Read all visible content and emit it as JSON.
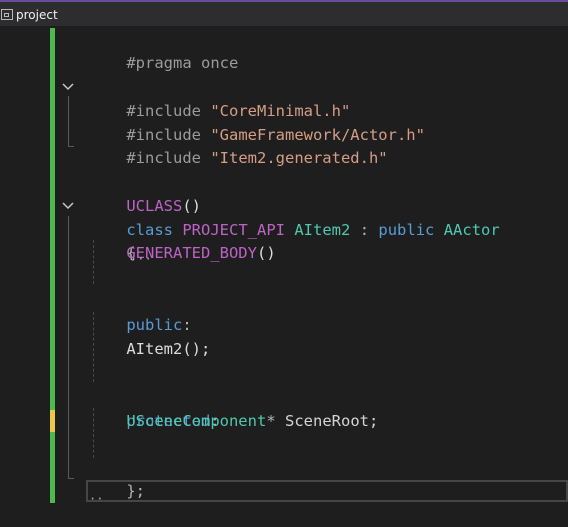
{
  "tab": {
    "label": "project",
    "icon": "project-icon"
  },
  "code": {
    "pragma": "#pragma once",
    "inc1_kw": "#include",
    "inc1_str": "\"CoreMinimal.h\"",
    "inc2_kw": "#include",
    "inc2_str": "\"GameFramework/Actor.h\"",
    "inc3_kw": "#include",
    "inc3_str": "\"Item2.generated.h\"",
    "uclass": "UCLASS",
    "uclass_parens": "()",
    "class_kw": "class",
    "api": "PROJECT_API",
    "classname": "AItem2",
    "colon": ":",
    "public_kw": "public",
    "base": "AActor",
    "open_brace": "{",
    "gen_body": "GENERATED_BODY",
    "gen_parens": "()",
    "public_label": "public",
    "public_colon": ":",
    "ctor": "AItem2();",
    "protected_label": "protected",
    "protected_colon": ":",
    "member_type": "USceneComponent",
    "member_star": "*",
    "member_name": "SceneRoot;",
    "close_brace": "};"
  },
  "colors": {
    "background": "#1e1e1e",
    "change_bar": "#4fb94f",
    "change_bar_modified": "#e6c84a",
    "keyword": "#569cd6",
    "string": "#d69d85",
    "macro": "#bd63c5",
    "type": "#4ec9b0"
  }
}
